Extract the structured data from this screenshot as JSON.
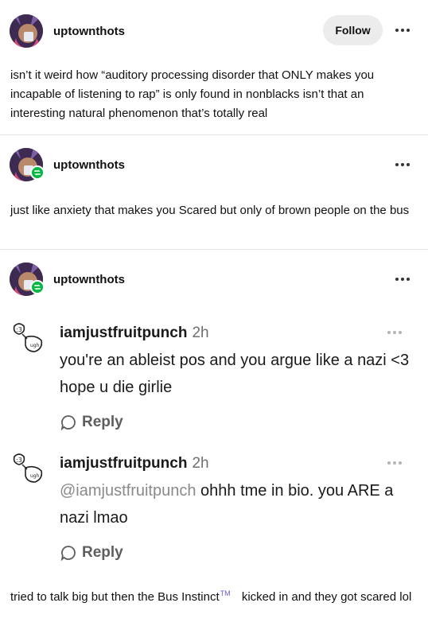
{
  "post1": {
    "username": "uptownthots",
    "follow_label": "Follow",
    "text": "isn’t it weird how “auditory processing disorder that ONLY makes you incapable of listening to rap” is only found in nonblacks isn’t that an interesting natural phenomenon that’s totally real"
  },
  "post2": {
    "username": "uptownthots",
    "text": "just like anxiety that makes you Scared but only of brown people on the bus"
  },
  "post3": {
    "username": "uptownthots",
    "comments": [
      {
        "username": "iamjustfruitpunch",
        "time": "2h",
        "text": "you're an ableist pos and you argue like a nazi <3 hope u die girlie",
        "reply_label": "Reply"
      },
      {
        "username": "iamjustfruitpunch",
        "time": "2h",
        "mention": "@iamjustfruitpunch",
        "text": " ohhh tme in bio. you ARE a nazi lmao",
        "reply_label": "Reply"
      }
    ],
    "caption_before": "tried to talk big but then the Bus Instinct",
    "caption_tm": "TM",
    "caption_after": " kicked in and they got scared lol"
  },
  "colors": {
    "reblog": "#00b843",
    "divider": "#e3e3e3",
    "follow_bg": "#ececec"
  }
}
